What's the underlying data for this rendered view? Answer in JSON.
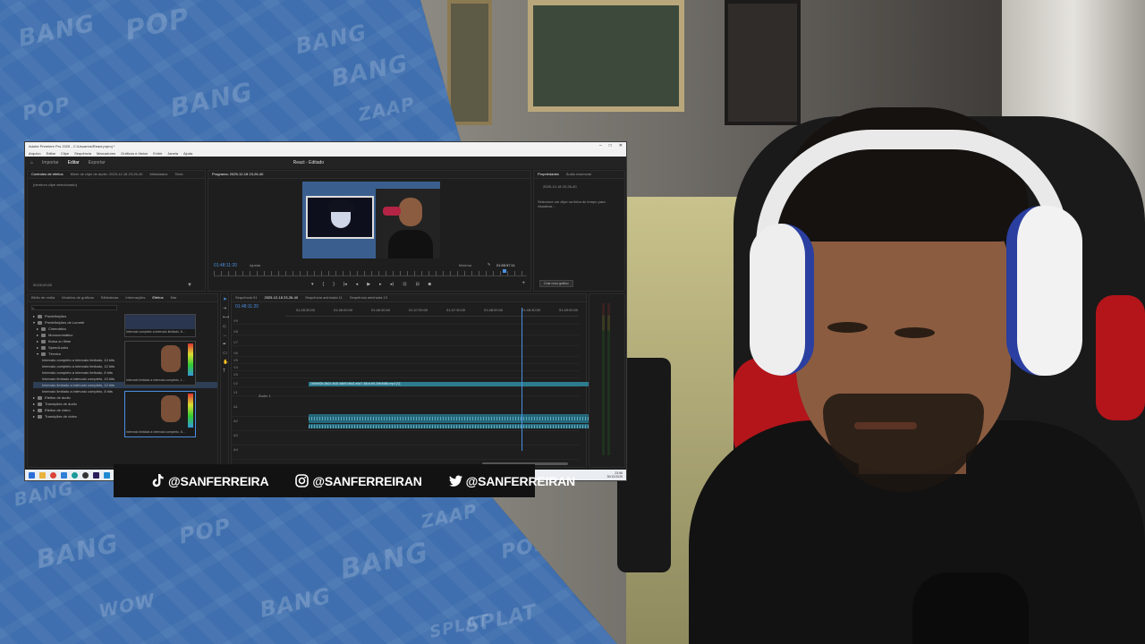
{
  "background": {
    "comic_words": [
      "BANG",
      "POP",
      "BANG",
      "BANG",
      "POP",
      "ZAAP",
      "BANG",
      "BANG",
      "POP",
      "BANG",
      "SPLAT",
      "WOW",
      "BANG",
      "POP",
      "ZAAP",
      "BANG",
      "SPLAT"
    ]
  },
  "premiere": {
    "window_title": "Adobe Premiere Pro 2025 - C:\\Usuarios\\React.prproj *",
    "menu": [
      "Arquivo",
      "Editar",
      "Clipe",
      "Sequência",
      "Marcadores",
      "Gráficos e títulos",
      "Exibir",
      "Janela",
      "Ajuda"
    ],
    "header_tabs": [
      "Importar",
      "Editar",
      "Exportar"
    ],
    "doc_title": "React - Editado",
    "source_panel": {
      "tabs": [
        "Controles de efeitos",
        "Mixer de clipe de áudio: 2025-12-18 23-26-40",
        "Metadados",
        "Textc"
      ],
      "empty_text": "(nenhum clipe selecionado)",
      "timecode": "00;00;00;00"
    },
    "program_panel": {
      "title": "Programa: 2025-12-18 23-26-40",
      "timecode_left": "01:48:11:20",
      "fit": "Ajustar",
      "quality": "Máxima",
      "timecode_right": "01:55:57:11"
    },
    "properties_panel": {
      "tabs": [
        "Propriedades",
        "Áudio essencial"
      ],
      "clip_name": "2025-12-18 23-26-40",
      "hint": "Selecione um clipe na linha do tempo para visualizar...",
      "button": "Criar novo gráfico"
    },
    "project_panel": {
      "tabs": [
        "Biblio de mídia",
        "Modelos de gráficos",
        "Bibliotecas",
        "Informações",
        "Efeitos",
        "Mar"
      ],
      "tree": [
        "Predefinições",
        "Predefinições de Lumetri",
        "Cinemático",
        "Monocromático",
        "Bolsa ou filme",
        "SpeedLooks",
        "Técnico",
        "Intervalo completo a intervalo limitado, 10 bits",
        "Intervalo completo a intervalo limitado, 12 bits",
        "Intervalo completo a intervalo limitado, 8 bits",
        "Intervalo limitado a intervalo completo, 10 bits",
        "Intervalo limitado a intervalo completo, 12 bits",
        "Intervalo limitado a intervalo completo, 8 bits",
        "Efeitos de áudio",
        "Transições de áudio",
        "Efeitos de vídeo",
        "Transições de vídeo"
      ],
      "thumb_caption_1": "Intervalo completo a intervalo limitado, 8...",
      "thumb_caption_2": "Intervalo limitado a intervalo completo, 1...",
      "thumb_caption_3": "Intervalo limitado a intervalo completo, 8..."
    },
    "timeline": {
      "tabs": [
        "Sequência 01",
        "2025-12-18 23-26-40",
        "Sequência aninhada 11",
        "Sequência aninhada 13"
      ],
      "timecode": "01:48:11:20",
      "ruler": [
        "01:45:30:00",
        "01:46:00:00",
        "01:46:30:00",
        "01:47:00:00",
        "01:47:30:00",
        "01:48:00:00",
        "01:48:30:00",
        "01:49:00:00"
      ],
      "tracks": [
        "V9",
        "V8",
        "V7",
        "V6",
        "V5",
        "V4",
        "V3",
        "V2",
        "V1",
        "A1",
        "A2",
        "A3",
        "A4"
      ],
      "clip_label": "1b5e6f2b-8b2c-4b2f-a8d9-b5a3-e6a7-48cd-b9-2dfc6d8c.mp4 [V]",
      "audio_label": "Áudio 1"
    },
    "taskbar": {
      "time": "23:56",
      "date": "30/12/2025"
    }
  },
  "social": {
    "tiktok": "@SANFERREIRA",
    "instagram": "@SANFERREIRAN",
    "twitter": "@SANFERREIRAN"
  }
}
